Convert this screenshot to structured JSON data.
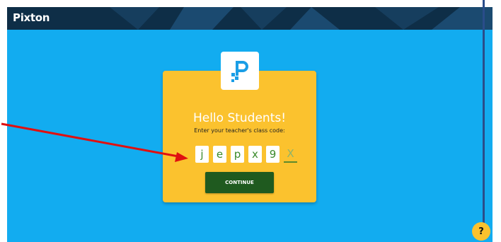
{
  "header": {
    "logo_text": "Pixton"
  },
  "card": {
    "title": "Hello Students!",
    "subtitle": "Enter your teacher's class code:",
    "code_chars": [
      "j",
      "e",
      "p",
      "x",
      "9",
      "X"
    ],
    "continue_label": "CONTINUE"
  },
  "help": {
    "label": "?"
  },
  "icons": {
    "brand": "pixton-p-icon",
    "help": "help-icon",
    "annotation": "red-arrow-annotation"
  },
  "colors": {
    "background": "#12acf0",
    "header": "#0e2e47",
    "card": "#fbc22e",
    "button": "#1f5a1f",
    "code_text": "#3a8a2a",
    "arrow": "#e01010"
  }
}
